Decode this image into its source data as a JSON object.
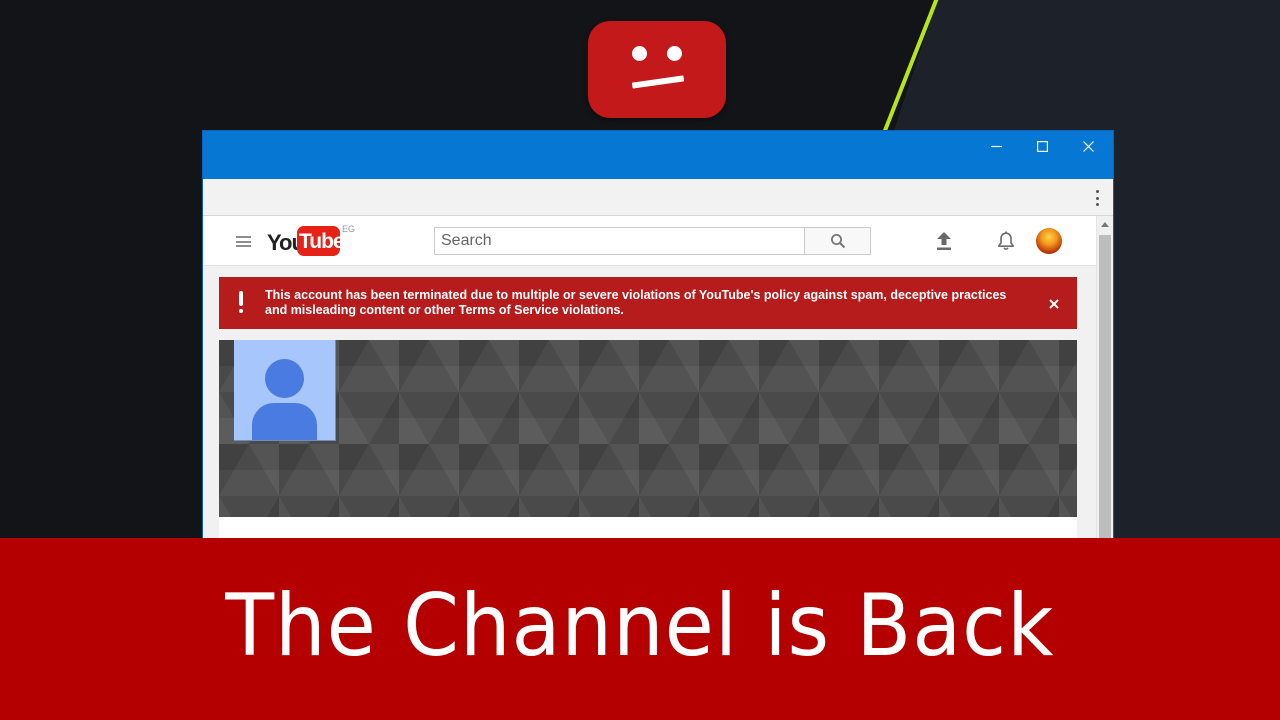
{
  "colors": {
    "accent_line": "#b5e61d",
    "titlebar": "#0678d4",
    "alert_bg": "#b71c1c",
    "caption_bg": "#b40000",
    "youtube_red": "#e62117"
  },
  "window": {
    "controls": {
      "minimize_icon": "minimize-icon",
      "maximize_icon": "maximize-icon",
      "close_icon": "close-icon"
    }
  },
  "youtube": {
    "logo": {
      "you": "You",
      "tube": "Tube",
      "country": "EG"
    },
    "search": {
      "placeholder": "Search",
      "value": ""
    },
    "icons": [
      "menu-icon",
      "search-icon",
      "upload-icon",
      "bell-icon"
    ]
  },
  "alert": {
    "message": "This account has been terminated due to multiple or severe violations of YouTube's policy against spam, deceptive practices and misleading content or other Terms of Service violations."
  },
  "caption": {
    "text": "The Channel is Back"
  }
}
